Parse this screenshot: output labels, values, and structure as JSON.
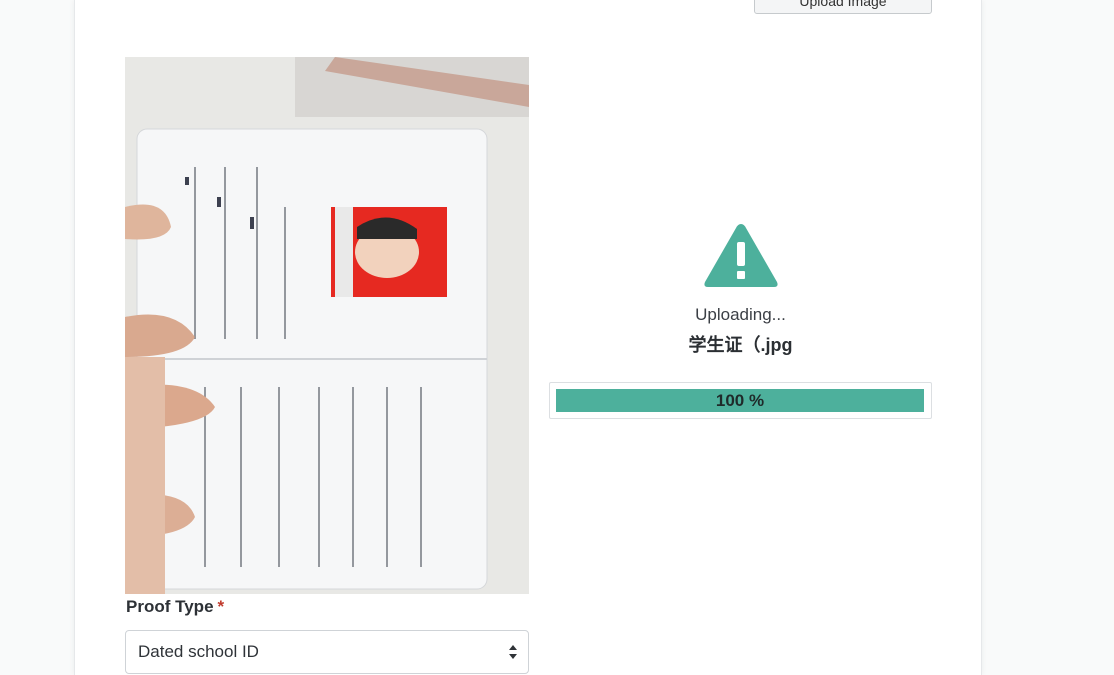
{
  "top_button": {
    "label": "Upload Image"
  },
  "photo": {
    "description_icon": "student-id-photo"
  },
  "upload": {
    "status": "Uploading...",
    "filename": "学生证（.jpg",
    "progress_percent": 100,
    "progress_label": "100 %",
    "icon": "warning-triangle-icon",
    "accent_color": "#4db09c"
  },
  "form": {
    "proof_type_label": "Proof Type",
    "required_marker": "*",
    "proof_type_value": "Dated school ID"
  }
}
